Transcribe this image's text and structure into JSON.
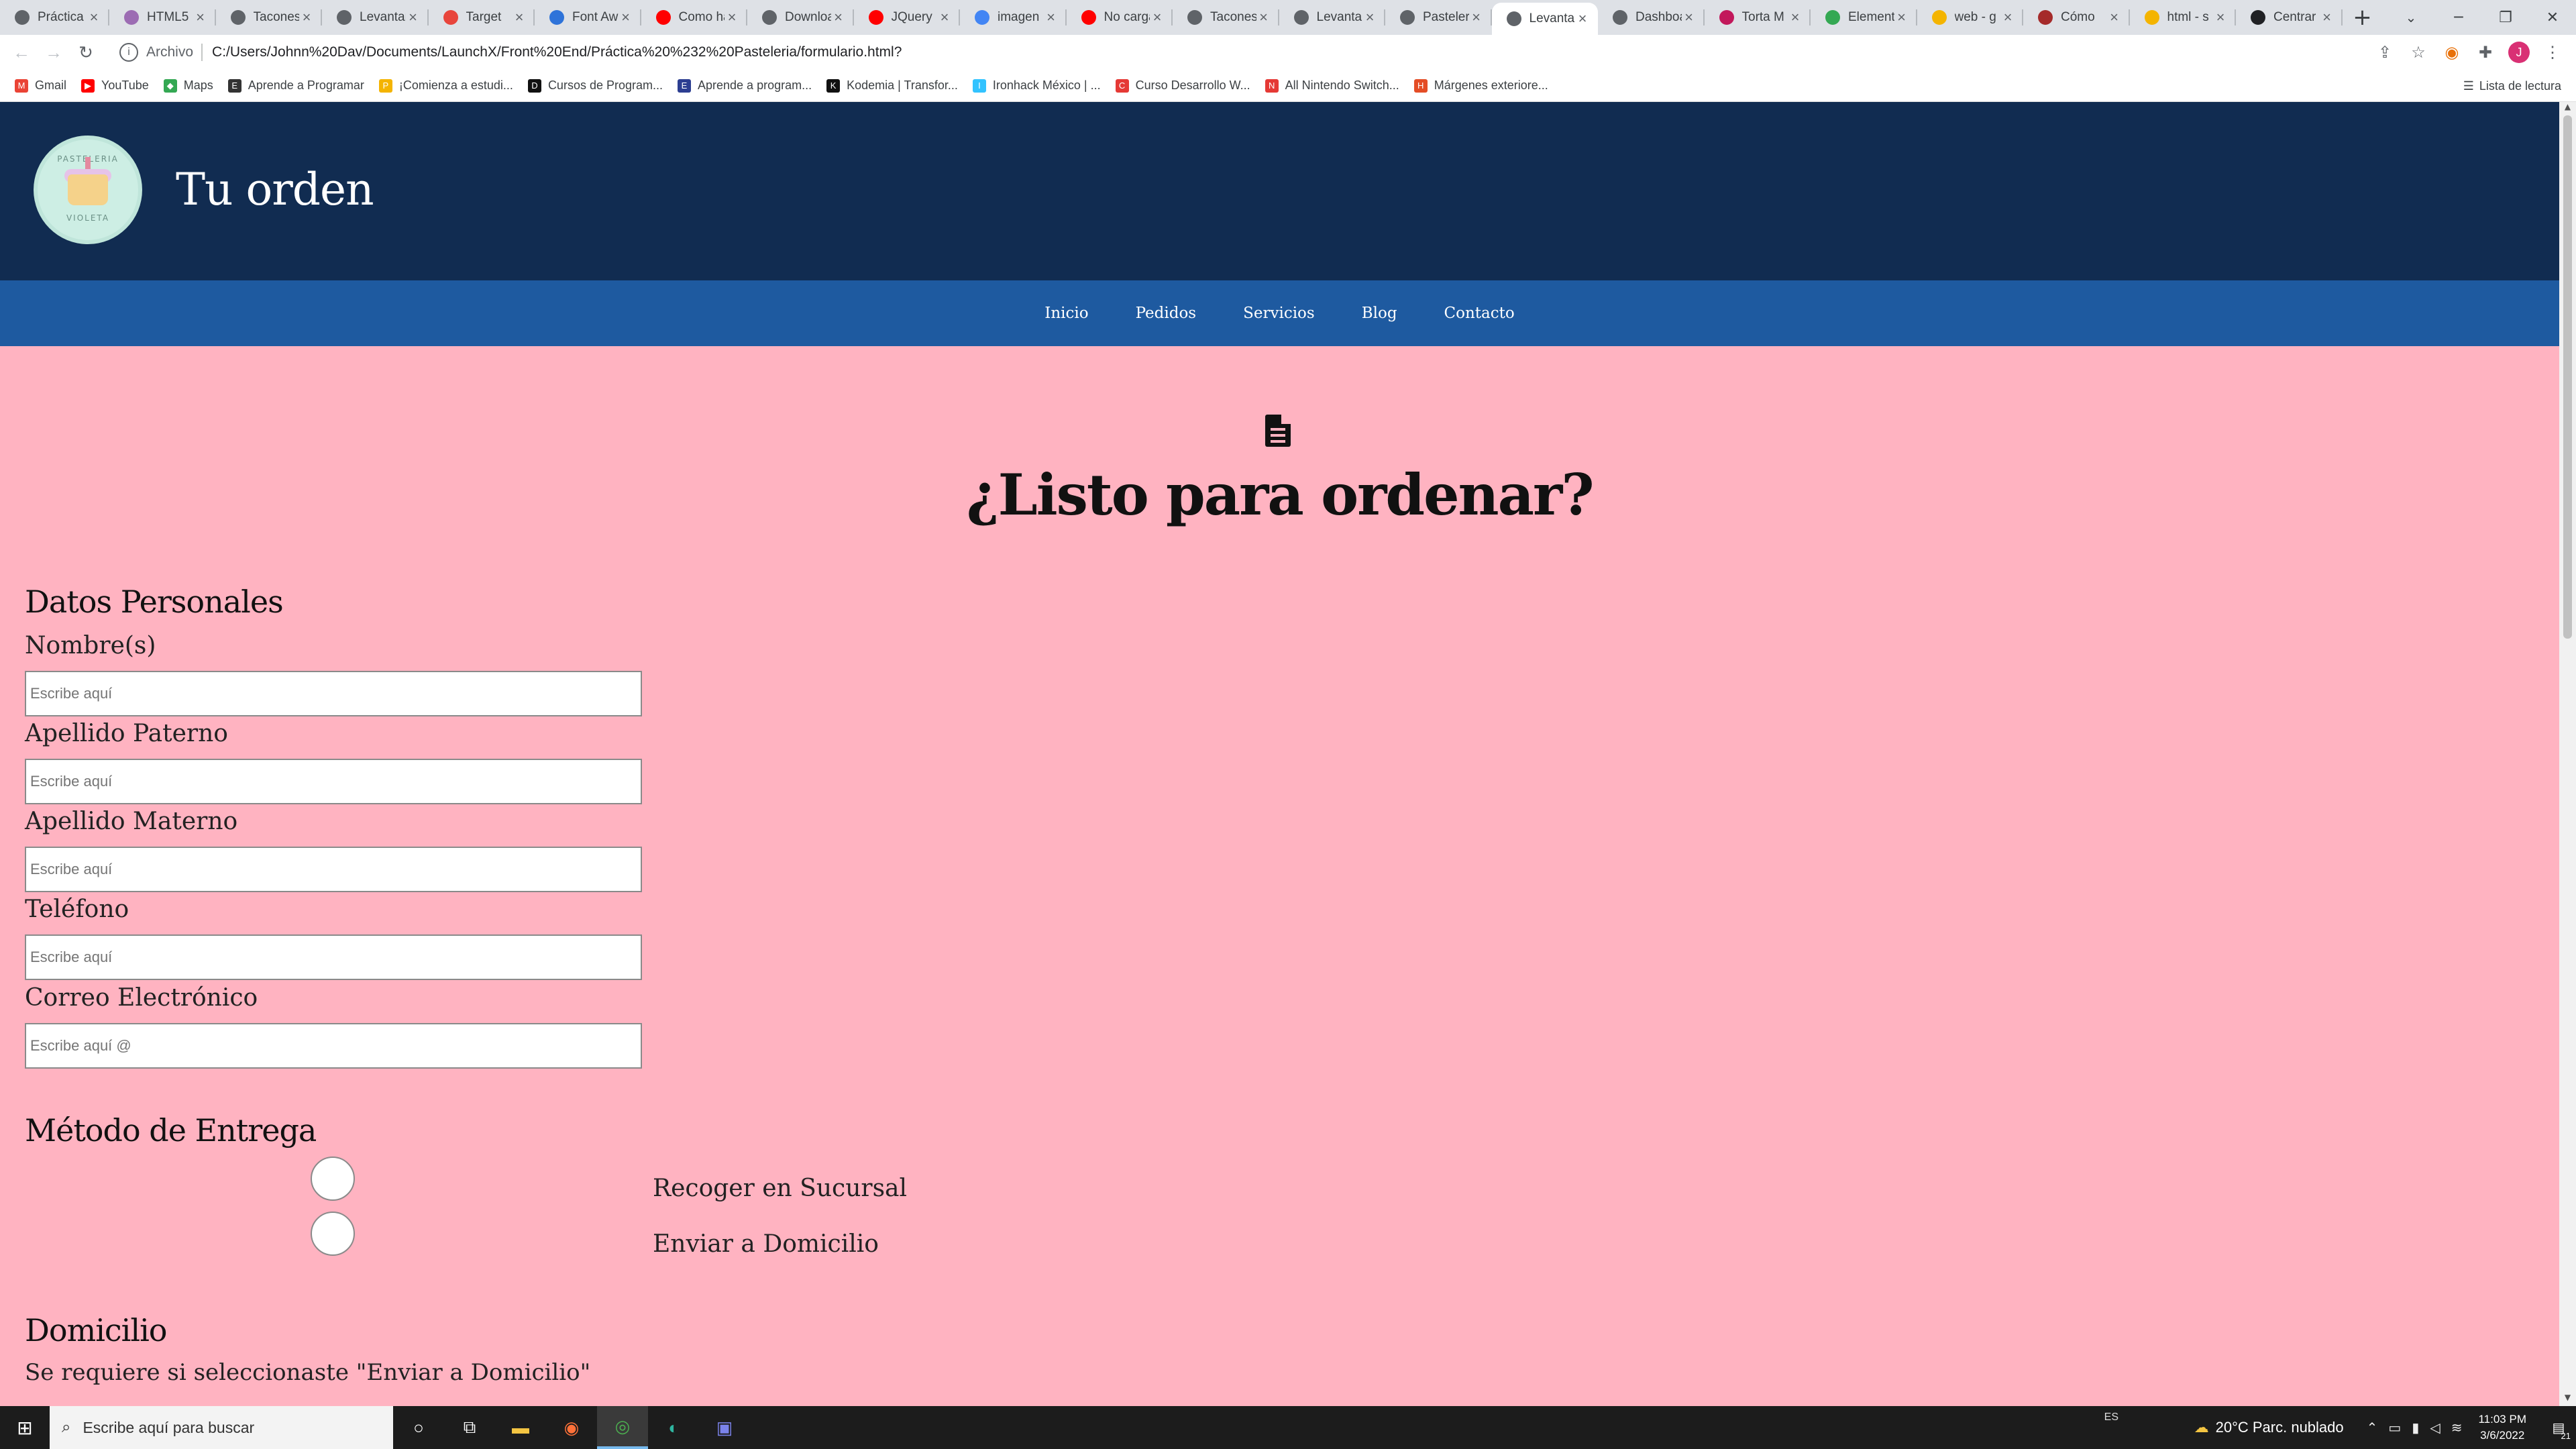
{
  "browser": {
    "tabs": [
      {
        "title": "Práctica",
        "color": "#5f6368"
      },
      {
        "title": "HTML5",
        "color": "#9c6cb3"
      },
      {
        "title": "Tacones",
        "color": "#5f6368"
      },
      {
        "title": "Levantamiento",
        "color": "#5f6368"
      },
      {
        "title": "Target",
        "color": "#e8453c"
      },
      {
        "title": "Font Awesome",
        "color": "#2e73d9"
      },
      {
        "title": "Como hacer",
        "color": "#ff0000"
      },
      {
        "title": "Downloads",
        "color": "#5f6368"
      },
      {
        "title": "JQuery",
        "color": "#ff0000"
      },
      {
        "title": "imagen",
        "color": "#4285f4"
      },
      {
        "title": "No carga",
        "color": "#ff0000"
      },
      {
        "title": "Tacones",
        "color": "#5f6368"
      },
      {
        "title": "Levantamiento",
        "color": "#5f6368"
      },
      {
        "title": "Pastelería",
        "color": "#5f6368"
      },
      {
        "title": "Levantamiento",
        "color": "#5f6368"
      },
      {
        "title": "Dashboard",
        "color": "#5f6368"
      },
      {
        "title": "Torta M",
        "color": "#c2185b"
      },
      {
        "title": "Elementos",
        "color": "#34a853"
      },
      {
        "title": "web - g",
        "color": "#f4b400"
      },
      {
        "title": "Cómo",
        "color": "#a52a2a"
      },
      {
        "title": "html - s",
        "color": "#f4b400"
      },
      {
        "title": "Centrar",
        "color": "#202124"
      }
    ],
    "active_tab_index": 14,
    "new_tab_symbol": "+",
    "address": {
      "chip": "Archivo",
      "url": "C:/Users/Johnn%20Dav/Documents/LaunchX/Front%20End/Práctica%20%232%20Pasteleria/formulario.html?"
    },
    "profile_initial": "J",
    "bookmarks": [
      {
        "label": "Gmail",
        "color": "#ea4335",
        "glyph": "M"
      },
      {
        "label": "YouTube",
        "color": "#ff0000",
        "glyph": "▶"
      },
      {
        "label": "Maps",
        "color": "#34a853",
        "glyph": "◆"
      },
      {
        "label": "Aprende a Programar",
        "color": "#333333",
        "glyph": "E"
      },
      {
        "label": "¡Comienza a estudi...",
        "color": "#f4b400",
        "glyph": "P"
      },
      {
        "label": "Cursos de Program...",
        "color": "#111111",
        "glyph": "D"
      },
      {
        "label": "Aprende a program...",
        "color": "#2c3e91",
        "glyph": "E"
      },
      {
        "label": "Kodemia | Transfor...",
        "color": "#111111",
        "glyph": "K"
      },
      {
        "label": "Ironhack México | ...",
        "color": "#32c3ff",
        "glyph": "I"
      },
      {
        "label": "Curso Desarrollo W...",
        "color": "#e53935",
        "glyph": "C"
      },
      {
        "label": "All Nintendo Switch...",
        "color": "#e53935",
        "glyph": "N"
      },
      {
        "label": "Márgenes exteriore...",
        "color": "#e44d26",
        "glyph": "H"
      }
    ],
    "reading_list": "Lista de lectura"
  },
  "site": {
    "logo_text_top": "PASTELERIA",
    "logo_text_bottom": "VIOLETA",
    "title": "Tu orden",
    "nav": [
      "Inicio",
      "Pedidos",
      "Servicios",
      "Blog",
      "Contacto"
    ]
  },
  "form": {
    "heading": "¿Listo para ordenar?",
    "personal_section": "Datos Personales",
    "fields": [
      {
        "label": "Nombre(s)",
        "placeholder": "Escribe aquí"
      },
      {
        "label": "Apellido Paterno",
        "placeholder": "Escribe aquí"
      },
      {
        "label": "Apellido Materno",
        "placeholder": "Escribe aquí"
      },
      {
        "label": "Teléfono",
        "placeholder": "Escribe aquí"
      },
      {
        "label": "Correo Electrónico",
        "placeholder": "Escribe aquí @"
      }
    ],
    "delivery_section": "Método de Entrega",
    "delivery_options": [
      "Recoger en Sucursal",
      "Enviar a Domicilio"
    ],
    "address_section": "Domicilio",
    "address_note": "Se requiere si seleccionaste \"Enviar a Domicilio\""
  },
  "taskbar": {
    "search_placeholder": "Escribe aquí para buscar",
    "language": "ES",
    "weather": "20°C  Parc. nublado",
    "time": "11:03 PM",
    "date": "3/6/2022",
    "notification_count": "21"
  }
}
